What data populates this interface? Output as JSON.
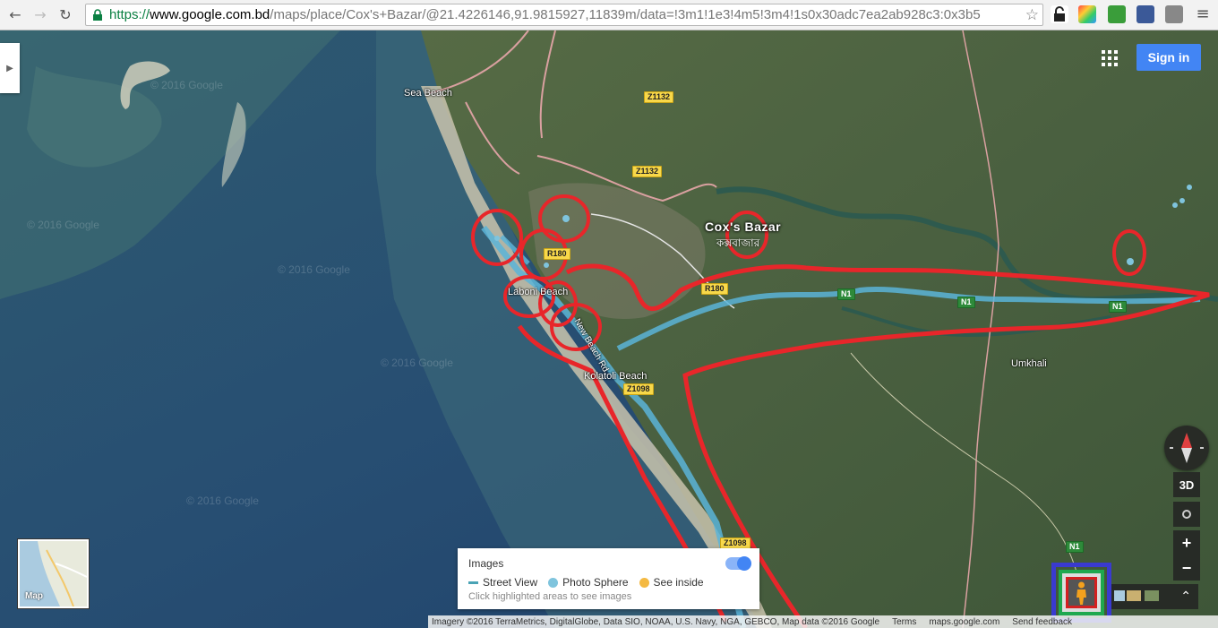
{
  "browser": {
    "url_scheme": "https://",
    "url_host": "www.google.com.bd",
    "url_path": "/maps/place/Cox's+Bazar/@21.4226146,91.9815927,11839m/data=!3m1!1e3!4m5!3m4!1s0x30adc7ea2ab928c3:0x3b5",
    "back_icon": "arrow-left-icon",
    "forward_icon": "arrow-right-icon",
    "reload_icon": "reload-icon",
    "bookmark_icon": "star-icon"
  },
  "map": {
    "type": "satellite",
    "watermark": "© 2016 Google",
    "places": {
      "sea_beach": "Sea Beach",
      "laboni_beach": "Laboni Beach",
      "kolatoli_beach": "Kolatoli Beach",
      "umkhali": "Umkhali",
      "marine_drive": "New Beach Rd",
      "city": "Cox's Bazar",
      "city_bengali": "কক্সবাজার"
    },
    "roads": {
      "z1132_a": "Z1132",
      "z1132_b": "Z1132",
      "r180_a": "R180",
      "r180_b": "R180",
      "n1_a": "N1",
      "n1_b": "N1",
      "n1_c": "N1",
      "n1_d": "N1",
      "z1098_a": "Z1098",
      "z1098_b": "Z1098"
    },
    "annotation_color": "#e8262a",
    "streetview_color": "#5ab4d8"
  },
  "controls": {
    "sign_in": "Sign in",
    "three_d": "3D",
    "zoom_in": "+",
    "zoom_out": "−",
    "expand": "⌃",
    "thumbnail_label": "Map"
  },
  "images_panel": {
    "title": "Images",
    "legend": [
      {
        "label": "Street View",
        "color": "#4aa3b5"
      },
      {
        "label": "Photo Sphere",
        "color": "#7fc4dd"
      },
      {
        "label": "See inside",
        "color": "#f4b942"
      }
    ],
    "hint": "Click highlighted areas to see images"
  },
  "footer": {
    "imagery": "Imagery ©2016 TerraMetrics, DigitalGlobe, Data SIO, NOAA, U.S. Navy, NGA, GEBCO, Map data ©2016 Google",
    "terms": "Terms",
    "site": "maps.google.com",
    "feedback": "Send feedback"
  }
}
